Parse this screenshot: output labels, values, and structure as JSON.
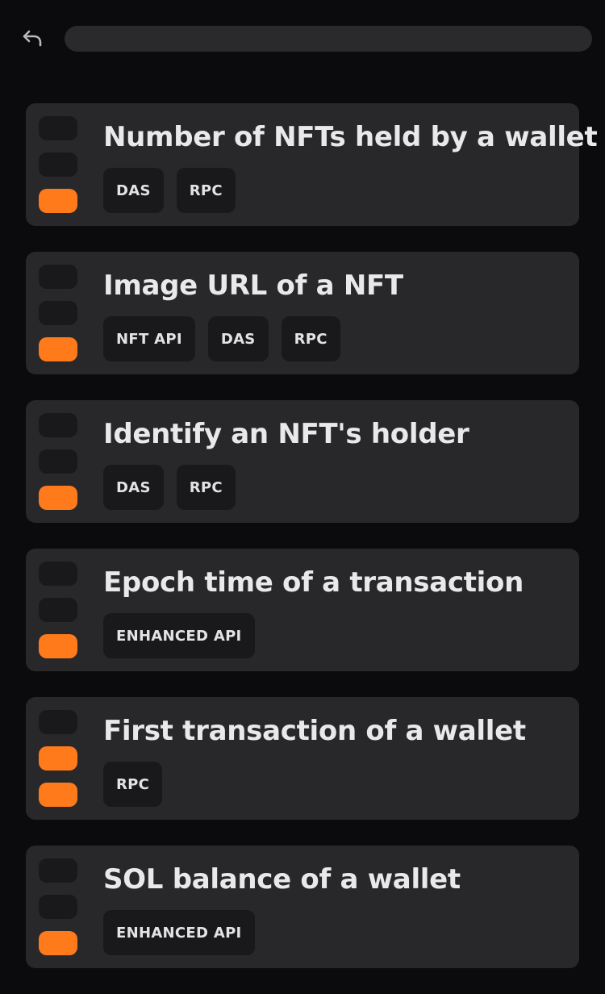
{
  "header": {
    "back_icon": "undo-arrow-icon",
    "search": {
      "value": "",
      "placeholder": ""
    }
  },
  "colors": {
    "background": "#0b0b0d",
    "card": "#28282b",
    "level_on": "#ff7a1a",
    "level_off": "#19191b",
    "tag_bg": "#19191b"
  },
  "cards": [
    {
      "title": "Number of NFTs held by a wallet",
      "tags": [
        "DAS",
        "RPC"
      ],
      "level": 1
    },
    {
      "title": "Image URL of a NFT",
      "tags": [
        "NFT API",
        "DAS",
        "RPC"
      ],
      "level": 1
    },
    {
      "title": "Identify an NFT's holder",
      "tags": [
        "DAS",
        "RPC"
      ],
      "level": 1
    },
    {
      "title": "Epoch time of a transaction",
      "tags": [
        "ENHANCED API"
      ],
      "level": 1
    },
    {
      "title": "First transaction of a wallet",
      "tags": [
        "RPC"
      ],
      "level": 2
    },
    {
      "title": "SOL balance of a wallet",
      "tags": [
        "ENHANCED API"
      ],
      "level": 1
    }
  ]
}
